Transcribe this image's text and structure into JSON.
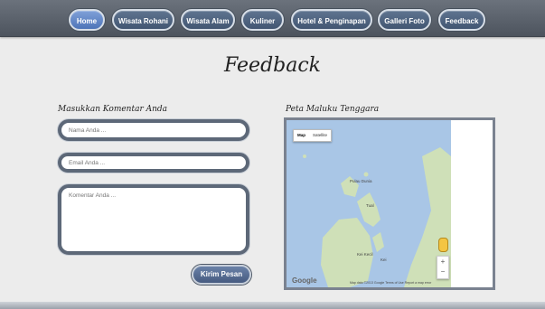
{
  "nav": {
    "items": [
      "Home",
      "Wisata Rohani",
      "Wisata Alam",
      "Kuliner",
      "Hotel & Penginapan",
      "Galleri Foto",
      "Feedback"
    ],
    "active_index": 0
  },
  "page": {
    "title": "Feedback"
  },
  "form": {
    "label": "Masukkan Komentar Anda",
    "name_placeholder": "Nama Anda ...",
    "email_placeholder": "Email Anda ...",
    "comment_placeholder": "Komentar Anda ...",
    "submit_label": "Kirim Pesan"
  },
  "map": {
    "label": "Peta Maluku Tenggara",
    "type_map": "Map",
    "type_satellite": "Satellite",
    "place_1": "Pulau Dunia",
    "place_2": "Tual",
    "place_3": "Kei Kecil",
    "place_4": "Kei",
    "google": "Google",
    "attribution": "Map data ©2013 Google    Terms of Use    Report a map error",
    "zoom_in": "+",
    "zoom_out": "−"
  },
  "colors": {
    "navbar": "#5a616b",
    "nav_button": "#4e6380",
    "nav_active": "#5d80c0",
    "field_border": "#5d6878",
    "water": "#a9c6e6",
    "land": "#cfe0b8"
  }
}
